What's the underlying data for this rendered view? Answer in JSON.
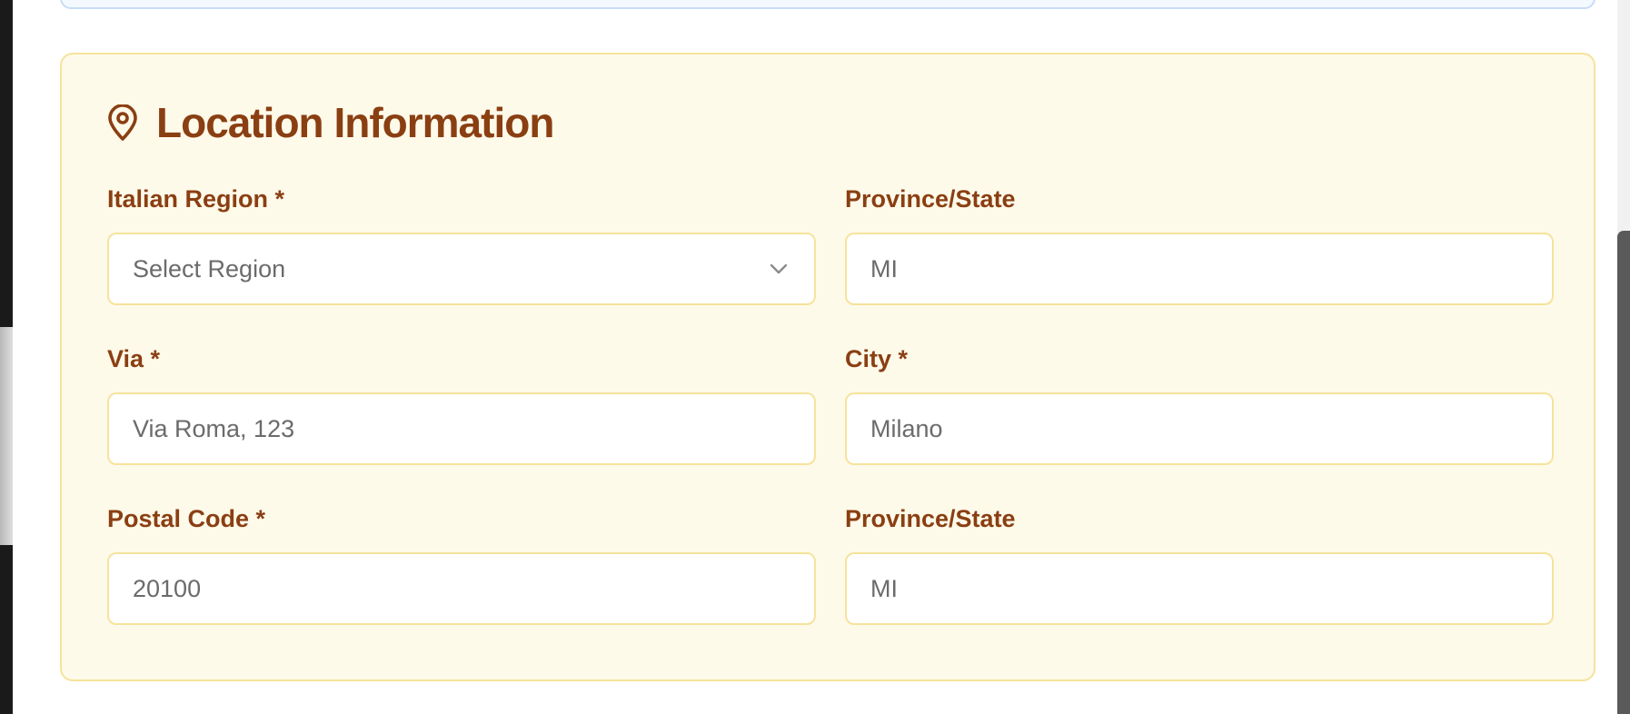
{
  "section": {
    "title": "Location Information",
    "icon": "map-pin-icon",
    "accent_color": "#8a3f12",
    "border_color": "#f6e39b",
    "background_color": "#fefaea"
  },
  "fields": {
    "region": {
      "label": "Italian Region *",
      "placeholder": "Select Region"
    },
    "province_top": {
      "label": "Province/State",
      "placeholder": "MI"
    },
    "via": {
      "label": "Via *",
      "placeholder": "Via Roma, 123"
    },
    "city": {
      "label": "City *",
      "placeholder": "Milano"
    },
    "postal_code": {
      "label": "Postal Code *",
      "placeholder": "20100"
    },
    "province_bottom": {
      "label": "Province/State",
      "placeholder": "MI"
    }
  }
}
